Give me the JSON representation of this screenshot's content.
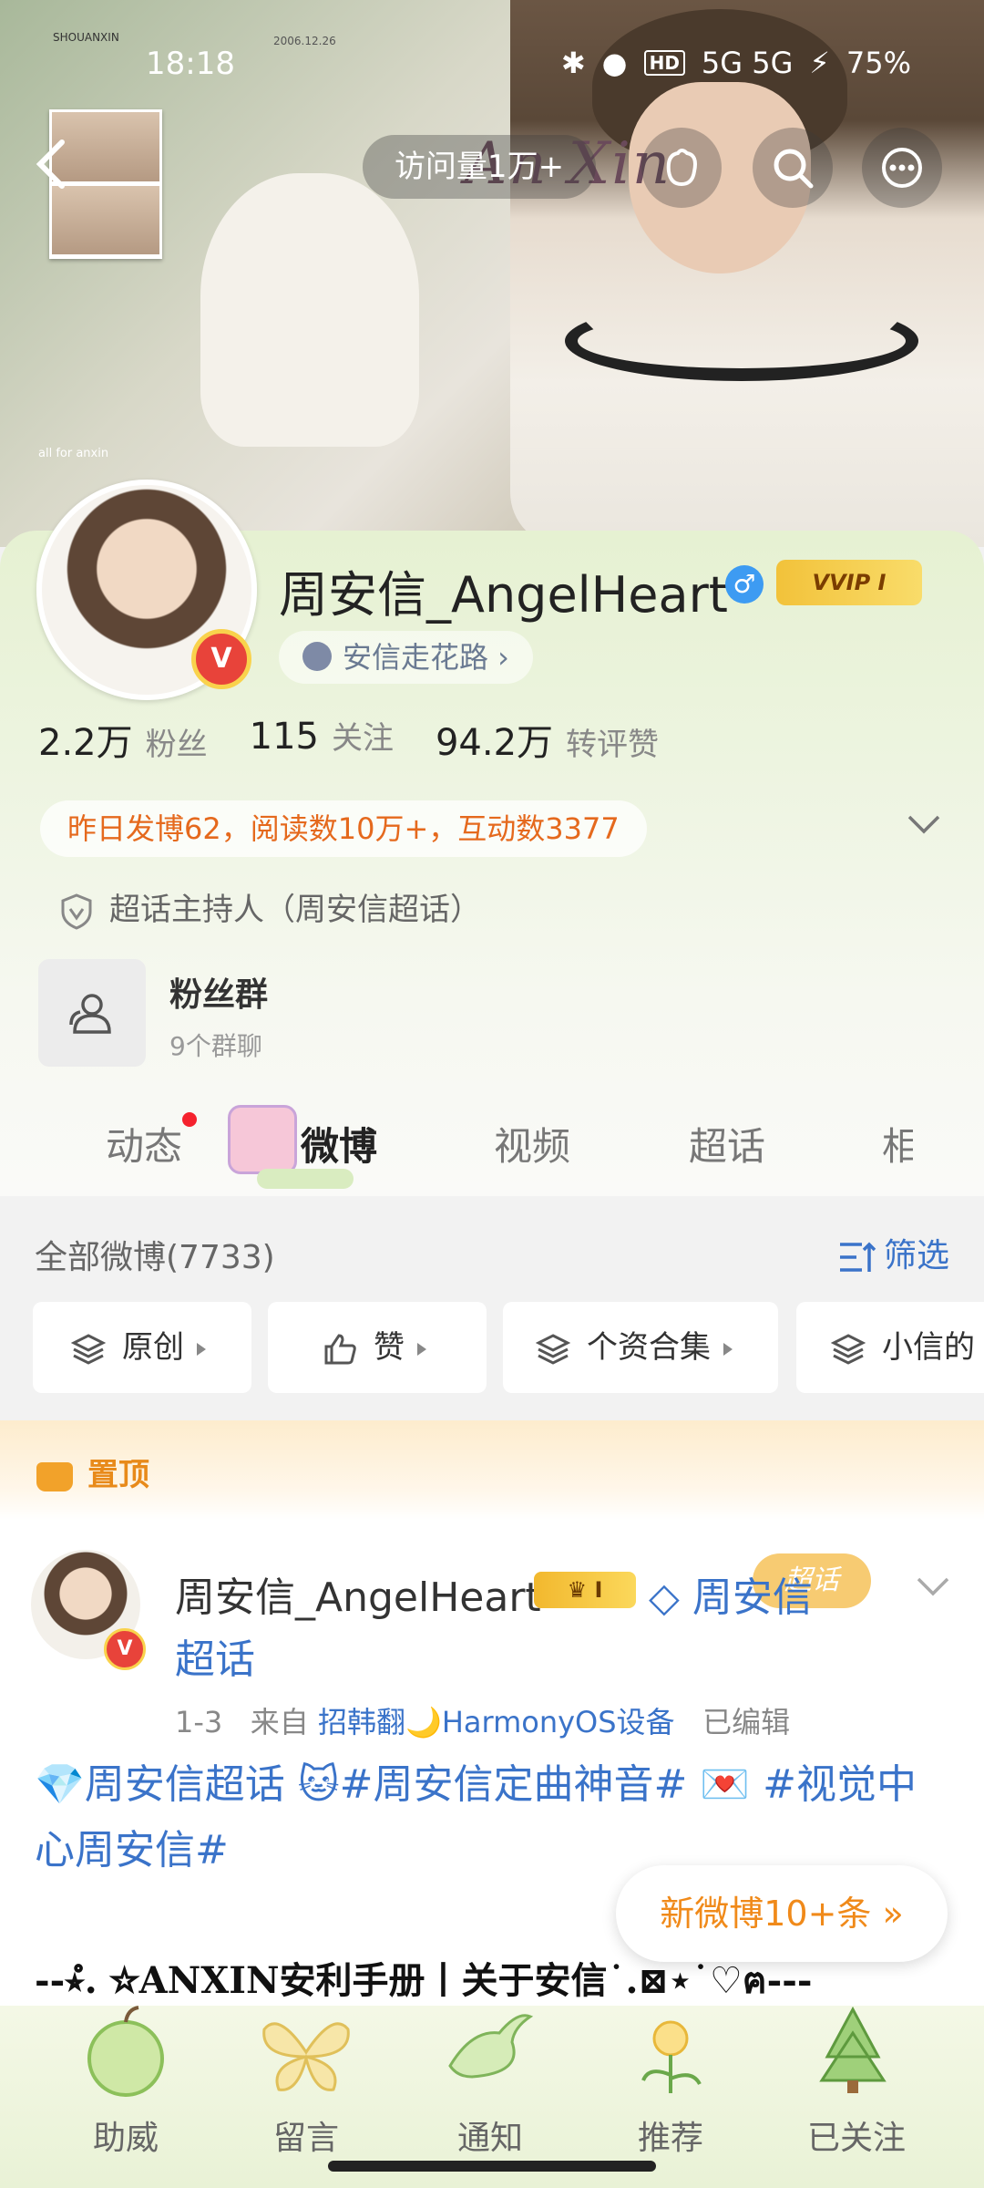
{
  "status_bar": {
    "time": "18:18",
    "network": "5G 5G",
    "hd": "HD",
    "battery": "75%"
  },
  "banner": {
    "caption_top_left": "SHOUANXIN",
    "caption_date": "2006.12.26",
    "caption_bottom": "all for anxin",
    "art_text": "An Xin"
  },
  "top_nav": {
    "visits": "访问量1万+"
  },
  "profile": {
    "name": "周安信_AngelHeart",
    "gender_symbol": "♂",
    "vip_label": "VVIP I",
    "verified_badge": "V",
    "tag_pill": "安信走花路 ›",
    "stats": [
      {
        "value": "2.2万",
        "label": "粉丝"
      },
      {
        "value": "115",
        "label": "关注"
      },
      {
        "value": "94.2万",
        "label": "转评赞"
      }
    ],
    "summary": "昨日发博62，阅读数10万+，互动数3377",
    "host_role": "超话主持人（周安信超话）",
    "fan_group": {
      "title": "粉丝群",
      "subtitle": "9个群聊"
    }
  },
  "tabs": [
    {
      "label": "动态",
      "has_dot": true
    },
    {
      "label": "微博",
      "active": true
    },
    {
      "label": "视频"
    },
    {
      "label": "超话"
    },
    {
      "label": "相"
    }
  ],
  "feed": {
    "all_count": "全部微博(7733)",
    "filter_label": "筛选",
    "chips": [
      {
        "label": "原创"
      },
      {
        "label": "赞"
      },
      {
        "label": "个资合集"
      },
      {
        "label": "小信的"
      }
    ],
    "pinned_label": "置顶",
    "pinned_post": {
      "author": "周安信_AngelHeart",
      "crown_level": "I",
      "topic_line1": "周安信",
      "topic_line2": "超话",
      "stamp": "超话",
      "date": "1-3",
      "from_prefix": "来自",
      "source": "招韩翻🌙HarmonyOS设备",
      "edited": "已编辑",
      "body": "💎周安信超话 🐱#周安信定曲神音# 💌 #视觉中心周安信#",
      "line2": "--⭒̊. ☆ANXIN安利手册丨关于安信˙.⊠⋆˙♡ฅ---"
    },
    "new_posts": "新微博10+条 »"
  },
  "bottom_nav": [
    {
      "label": "助威"
    },
    {
      "label": "留言"
    },
    {
      "label": "通知"
    },
    {
      "label": "推荐"
    },
    {
      "label": "已关注"
    }
  ],
  "colors": {
    "link_blue": "#3a73c9",
    "orange": "#e5691d",
    "card_green": "#e6f1d2"
  }
}
